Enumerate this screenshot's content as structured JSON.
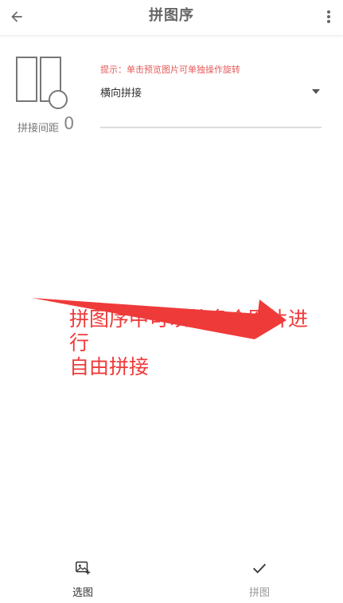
{
  "app_bar": {
    "title": "拼图序",
    "back_icon": "arrow-left-icon",
    "more_icon": "more-vert-icon"
  },
  "settings": {
    "preview_icon": "stitch-layout-preview-icon",
    "spacing_label": "拼接间距",
    "spacing_value": "0",
    "hint": "提示：单击预览图片可单独操作旋转",
    "mode_selected": "横向拼接",
    "dropdown_icon": "dropdown-arrow-icon"
  },
  "annotation": {
    "text_line1": "拼图序中可以将多个图片进行",
    "text_line2": "自由拼接",
    "color": "#ef3a3a"
  },
  "bottom_bar": {
    "select_label": "选图",
    "select_icon": "add-image-icon",
    "stitch_label": "拼图",
    "stitch_icon": "check-icon"
  }
}
